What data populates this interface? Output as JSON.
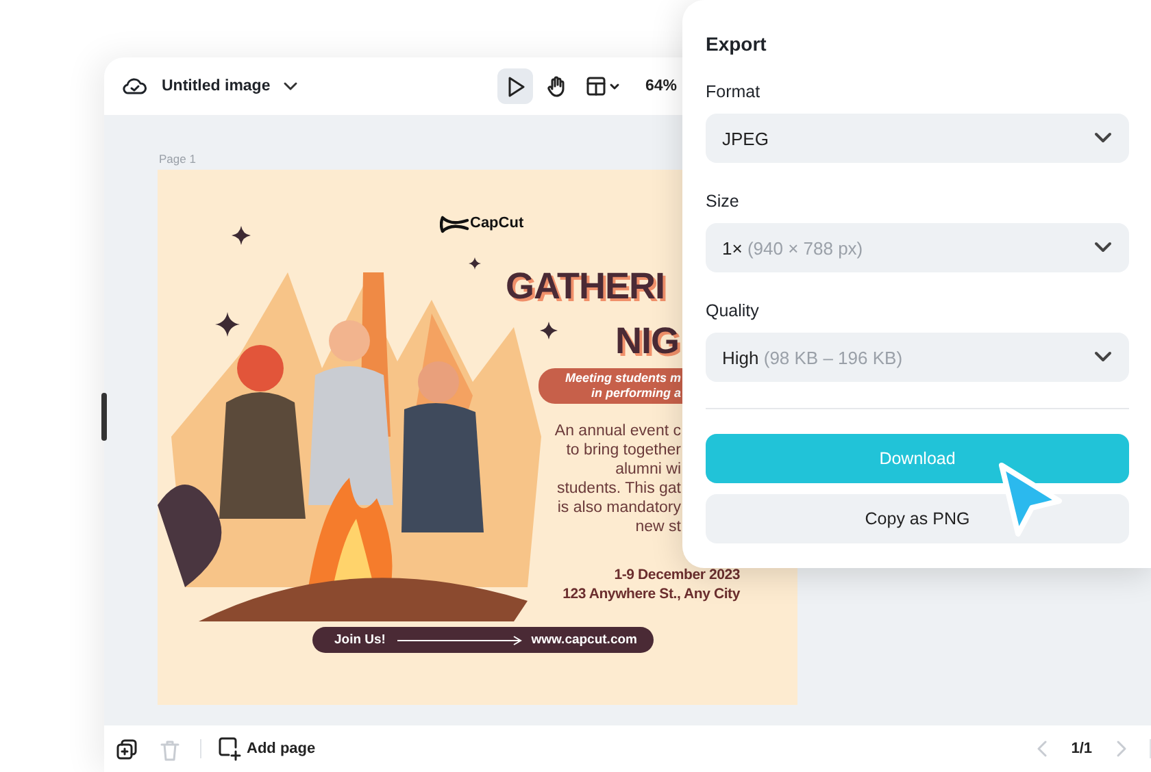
{
  "header": {
    "title": "Untitled image",
    "tools": [
      {
        "kind": "pointer",
        "selected": true
      },
      {
        "kind": "hand",
        "selected": false
      },
      {
        "kind": "layout",
        "selected": false
      }
    ],
    "zoom": "64%"
  },
  "canvas": {
    "page_label": "Page 1",
    "poster": {
      "brand": "CapCut",
      "title_lines": [
        "GATHERI",
        "NIG"
      ],
      "tagline_lines": [
        "Meeting students m",
        "in performing a"
      ],
      "description_lines": [
        "An annual event c",
        "to bring together",
        "alumni wi",
        "students. This gat",
        "is also mandatory",
        "new st"
      ],
      "date": "1-9 December 2023",
      "address": "123 Anywhere St., Any City",
      "cta": "Join Us!",
      "website": "www.capcut.com"
    }
  },
  "export_panel": {
    "title": "Export",
    "fields": [
      {
        "label": "Format",
        "value": "JPEG"
      },
      {
        "label": "Size",
        "value": "1×",
        "detail": "(940 × 788 px)"
      },
      {
        "label": "Quality",
        "value": "High",
        "detail": "(98 KB – 196 KB)"
      }
    ],
    "buttons": [
      {
        "label": "Download",
        "kind": "primary"
      },
      {
        "label": "Copy as PNG",
        "kind": "secondary"
      }
    ]
  },
  "footer": {
    "actions": [
      {
        "kind": "duplicate",
        "disabled": false
      },
      {
        "kind": "delete",
        "disabled": true
      }
    ],
    "add_page": "Add page",
    "pager": {
      "current": "1/1",
      "prev_disabled": true,
      "next_disabled": true
    }
  }
}
